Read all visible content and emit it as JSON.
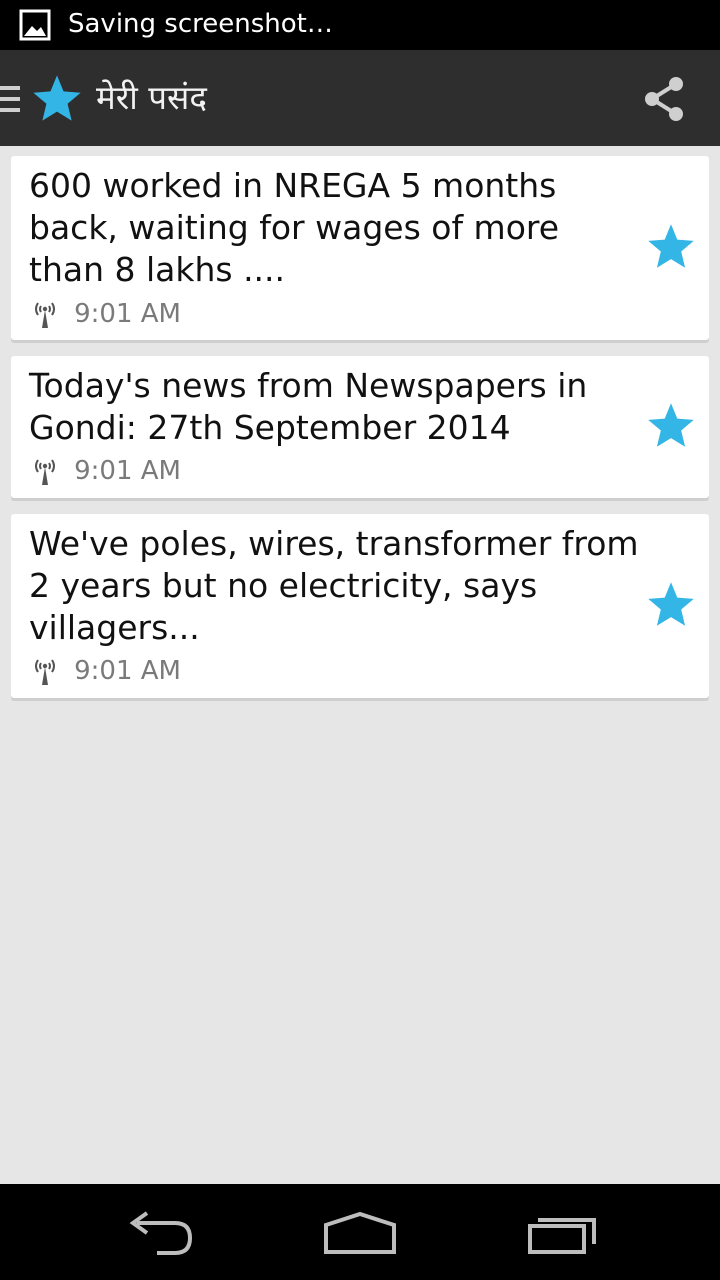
{
  "status_bar": {
    "notification_icon": "image-icon",
    "text": "Saving screenshot…"
  },
  "action_bar": {
    "drawer_icon": "menu-icon",
    "app_icon": "star-icon",
    "title": "मेरी पसंद",
    "share_icon": "share-icon"
  },
  "colors": {
    "accent": "#33b5e5",
    "action_bar_bg": "#2e2e2e",
    "list_bg": "#e6e6e6"
  },
  "items": [
    {
      "title": "600 worked in NREGA 5 months back, waiting for wages  of more than 8 lakhs ....",
      "icon": "antenna-icon",
      "time": "9:01 AM",
      "starred": true
    },
    {
      "title": "Today's news from Newspapers in Gondi: 27th September  2014",
      "icon": "antenna-icon",
      "time": "9:01 AM",
      "starred": true
    },
    {
      "title": "We've poles, wires, transformer from 2 years but no electricity, says villagers...",
      "icon": "antenna-icon",
      "time": "9:01 AM",
      "starred": true
    }
  ],
  "nav_bar": {
    "back_icon": "back-icon",
    "home_icon": "home-icon",
    "recents_icon": "recents-icon"
  }
}
